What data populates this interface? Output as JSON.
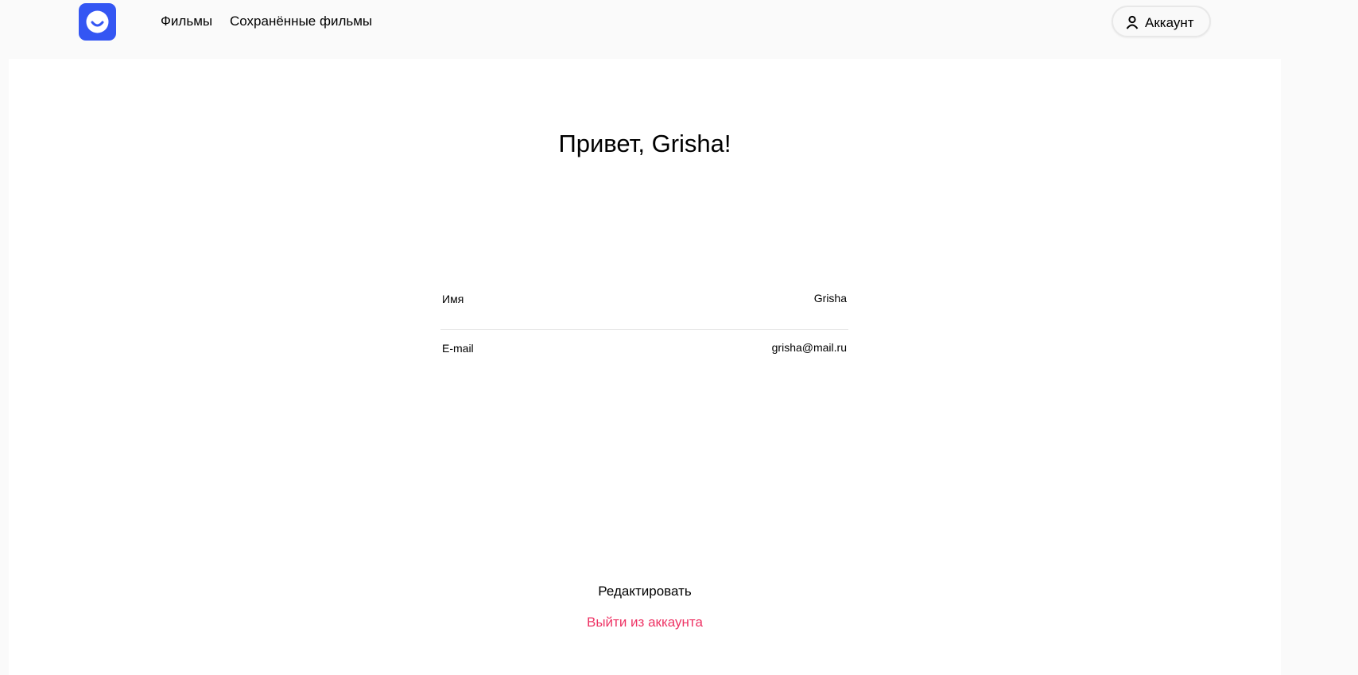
{
  "header": {
    "logo_icon": "smile-logo-icon",
    "nav": {
      "films": "Фильмы",
      "saved_films": "Сохранённые фильмы"
    },
    "account_button": {
      "label": "Аккаунт",
      "icon": "user-icon"
    }
  },
  "profile": {
    "greeting": "Привет, Grisha!",
    "fields": {
      "name_label": "Имя",
      "name_value": "Grisha",
      "email_label": "E-mail",
      "email_value": "grisha@mail.ru"
    },
    "edit_label": "Редактировать",
    "logout_label": "Выйти из аккаунта"
  },
  "colors": {
    "brand": "#3456f3",
    "danger": "#ee3465",
    "page_background": "#fafafa",
    "content_background": "#ffffff"
  }
}
